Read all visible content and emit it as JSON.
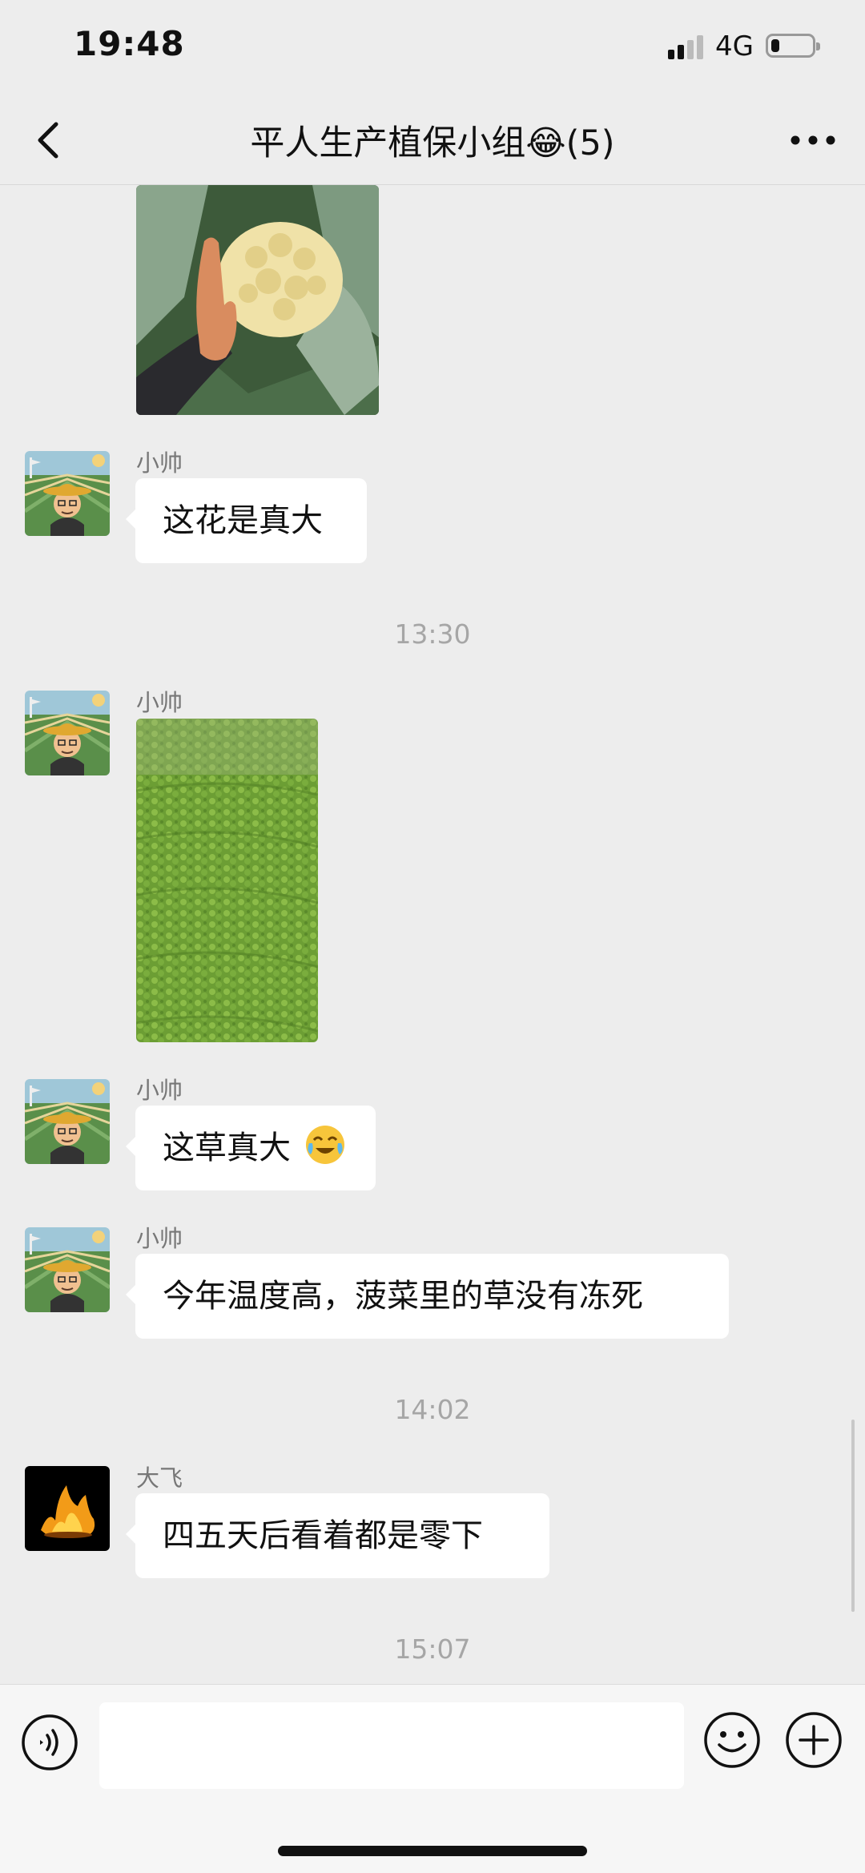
{
  "status_bar": {
    "time": "19:48",
    "network": "4G",
    "battery_level": 0.2
  },
  "header": {
    "title": "平人生产植保小组😂(5)"
  },
  "messages": {
    "m1": {
      "sender": "小帅",
      "text": "这花是真大"
    },
    "t1": "13:30",
    "m2": {
      "sender": "小帅"
    },
    "m3": {
      "sender": "小帅",
      "text": "这草真大"
    },
    "m4": {
      "sender": "小帅",
      "text": "今年温度高，菠菜里的草没有冻死"
    },
    "t2": "14:02",
    "m5": {
      "sender": "大飞",
      "text": "四五天后看着都是零下"
    },
    "t3": "15:07"
  },
  "icons": {
    "back": "chevron-left-icon",
    "more": "more-dots-icon",
    "voice": "voice-icon",
    "emoji": "smile-icon",
    "plus": "plus-circle-icon",
    "cry_laugh": "crying-laughing-emoji-icon"
  },
  "colors": {
    "background": "#ededed",
    "bubble": "#ffffff",
    "timestamp": "#a6a6a6",
    "sender_name": "#777777"
  }
}
